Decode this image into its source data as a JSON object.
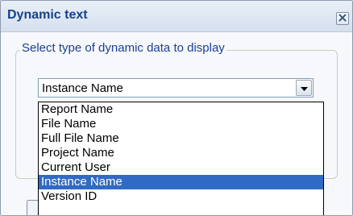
{
  "dialog": {
    "title": "Dynamic text",
    "close_icon": "close-icon"
  },
  "group": {
    "legend": "Select type of dynamic data to display"
  },
  "combo": {
    "value": "Instance Name",
    "button_icon": "chevron-down-icon"
  },
  "dropdown": {
    "options": [
      "Report Name",
      "File Name",
      "Full File Name",
      "Project Name",
      "Current User",
      "Instance Name",
      "Version ID"
    ],
    "selected": "Instance Name"
  },
  "colors": {
    "title": "#15428b",
    "legend": "#1c3f94",
    "selection": "#316ac5"
  }
}
